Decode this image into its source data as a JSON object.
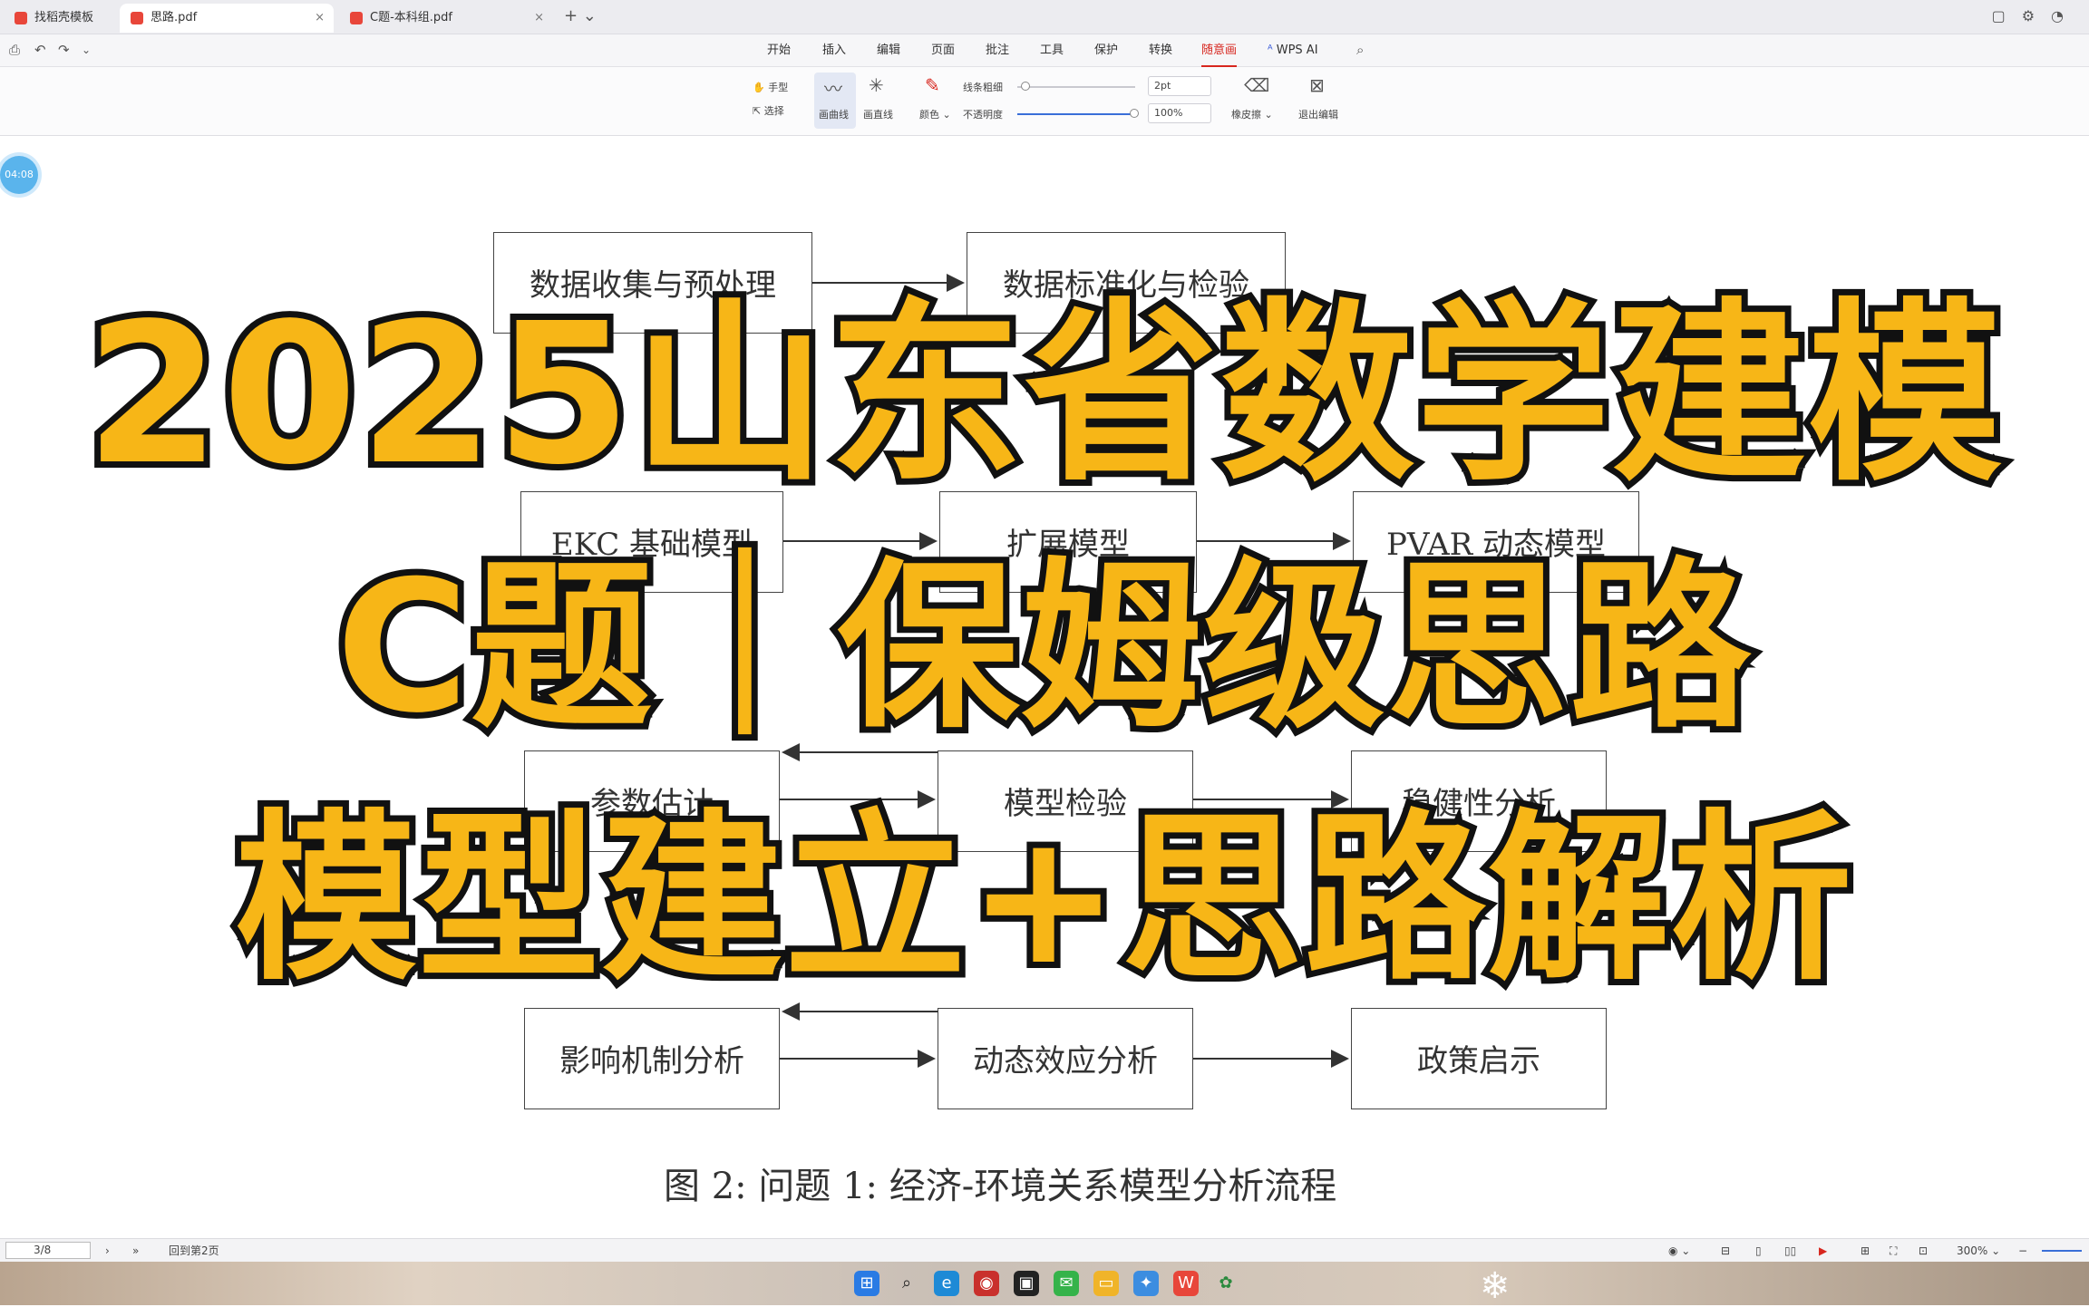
{
  "tabs": [
    {
      "label": "找稻壳模板",
      "active": false
    },
    {
      "label": "思路.pdf",
      "active": true
    },
    {
      "label": "C题-本科组.pdf",
      "active": false
    }
  ],
  "menu": [
    "开始",
    "插入",
    "编辑",
    "页面",
    "批注",
    "工具",
    "保护",
    "转换",
    "随意画",
    "WPS AI"
  ],
  "menu_active": "随意画",
  "ribbon": {
    "hand": "手型",
    "select": "选择",
    "curve": "画曲线",
    "straight": "画直线",
    "color": "颜色",
    "thickness": "线条粗细",
    "opacity": "不透明度",
    "thickness_value": "2pt",
    "opacity_value": "100%",
    "eraser": "橡皮擦",
    "exit": "退出编辑"
  },
  "timer": "04:08",
  "flowchart": {
    "row1": [
      "数据收集与预处理",
      "数据标准化与检验"
    ],
    "row2": [
      "EKC 基础模型",
      "扩展模型",
      "PVAR 动态模型"
    ],
    "row3": [
      "参数估计",
      "模型检验",
      "稳健性分析"
    ],
    "row4": [
      "影响机制分析",
      "动态效应分析",
      "政策启示"
    ],
    "caption": "图 2: 问题 1: 经济-环境关系模型分析流程"
  },
  "overlay": {
    "line1": "2025山东省数学建模",
    "line2": "C题｜保姆级思路",
    "line3": "模型建立+思路解析"
  },
  "status": {
    "page": "3/8",
    "goto": "回到第2页",
    "zoom": "300%"
  },
  "colors": {
    "overlay_fill": "#f7b617",
    "overlay_stroke": "#111111",
    "accent": "#d7261e"
  }
}
